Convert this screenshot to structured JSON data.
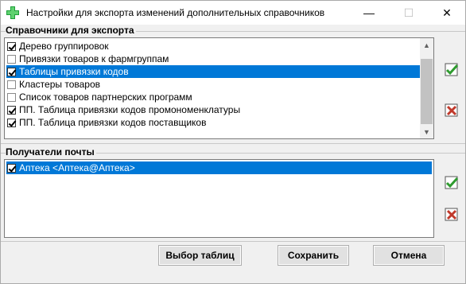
{
  "window": {
    "title": "Настройки для экспорта изменений дополнительных справочников",
    "min_glyph": "—",
    "max_glyph": "☐",
    "close_glyph": "✕"
  },
  "references_group": {
    "label": "Справочники  для экспорта",
    "items": [
      {
        "label": "Дерево группировок",
        "checked": true,
        "selected": false
      },
      {
        "label": "Привязки товаров к фармгруппам",
        "checked": false,
        "selected": false
      },
      {
        "label": "Таблицы привязки кодов",
        "checked": true,
        "selected": true
      },
      {
        "label": "Кластеры товаров",
        "checked": false,
        "selected": false
      },
      {
        "label": "Список товаров партнерских программ",
        "checked": false,
        "selected": false
      },
      {
        "label": "ПП. Таблица привязки кодов промономенклатуры",
        "checked": true,
        "selected": false
      },
      {
        "label": "ПП. Таблица привязки кодов поставщиков",
        "checked": true,
        "selected": false
      }
    ]
  },
  "recipients_group": {
    "label": "Получатели почты",
    "items": [
      {
        "label": "Аптека <Аптека@Аптека>",
        "checked": true,
        "selected": true
      }
    ]
  },
  "side_icons": {
    "check_all": "check-all-icon",
    "uncheck_all": "uncheck-all-icon"
  },
  "buttons": {
    "select_tables": "Выбор таблиц",
    "save": "Сохранить",
    "cancel": "Отмена"
  },
  "colors": {
    "selection": "#0078d7",
    "check_green": "#2e9b2e",
    "cross_red": "#c0392b"
  }
}
